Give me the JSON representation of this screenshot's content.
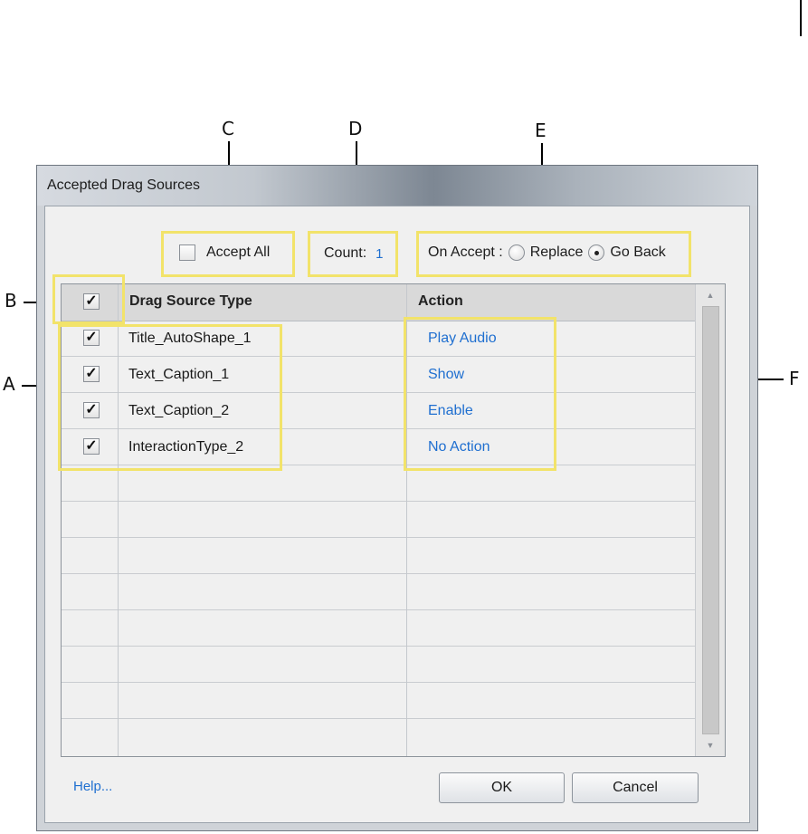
{
  "callouts": {
    "a": "A",
    "b": "B",
    "c": "C",
    "d": "D",
    "e": "E",
    "f": "F"
  },
  "dialog": {
    "title": "Accepted Drag Sources",
    "accept_all_label": "Accept All",
    "count_label": "Count:",
    "count_value": "1",
    "on_accept_label": "On Accept :",
    "radio_replace_label": "Replace",
    "radio_goback_label": "Go Back",
    "radio_selected": "Go Back"
  },
  "grid": {
    "header_check_mark": "✓",
    "headers": [
      "Drag Source Type",
      "Action"
    ],
    "rows": [
      {
        "checked": "✓",
        "source": "Title_AutoShape_1",
        "action": "Play Audio"
      },
      {
        "checked": "✓",
        "source": "Text_Caption_1",
        "action": "Show"
      },
      {
        "checked": "✓",
        "source": "Text_Caption_2",
        "action": "Enable"
      },
      {
        "checked": "✓",
        "source": "InteractionType_2",
        "action": "No Action"
      }
    ]
  },
  "footer": {
    "help_label": "Help...",
    "ok_label": "OK",
    "cancel_label": "Cancel"
  },
  "colors": {
    "highlight": "#f2e36a",
    "link": "#1f6fd0"
  },
  "icons": {
    "scroll_up": "scroll-up-arrow-icon",
    "scroll_down": "scroll-down-arrow-icon"
  }
}
